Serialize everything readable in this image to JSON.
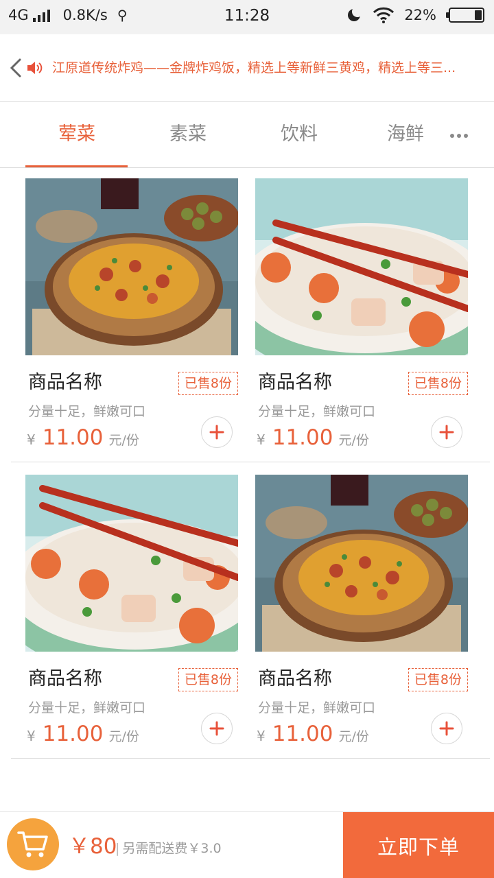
{
  "status_bar": {
    "network": "4G",
    "speed": "0.8K/s",
    "time": "11:28",
    "battery_percent": "22%",
    "battery_level": 0.22
  },
  "header": {
    "notice": "江原道传统炸鸡——金牌炸鸡饭，精选上等新鲜三黄鸡，精选上等三..."
  },
  "tabs": [
    {
      "label": "荤菜",
      "active": true
    },
    {
      "label": "素菜",
      "active": false
    },
    {
      "label": "饮料",
      "active": false
    },
    {
      "label": "海鲜",
      "active": false
    }
  ],
  "products": [
    {
      "name": "商品名称",
      "sold": "已售8份",
      "desc": "分量十足，鲜嫩可口",
      "currency": "¥",
      "price": "11.00",
      "unit": "元/份",
      "image": "paella"
    },
    {
      "name": "商品名称",
      "sold": "已售8份",
      "desc": "分量十足，鲜嫩可口",
      "currency": "¥",
      "price": "11.00",
      "unit": "元/份",
      "image": "fried-rice-chopsticks"
    },
    {
      "name": "商品名称",
      "sold": "已售8份",
      "desc": "分量十足，鲜嫩可口",
      "currency": "¥",
      "price": "11.00",
      "unit": "元/份",
      "image": "fried-rice-chopsticks"
    },
    {
      "name": "商品名称",
      "sold": "已售8份",
      "desc": "分量十足，鲜嫩可口",
      "currency": "¥",
      "price": "11.00",
      "unit": "元/份",
      "image": "paella"
    }
  ],
  "cart": {
    "total": "￥80",
    "delivery_note": "另需配送费￥3.0",
    "order_label": "立即下单"
  },
  "colors": {
    "accent": "#e8613a",
    "cart": "#f5a33d",
    "order_button": "#f26a3c"
  }
}
